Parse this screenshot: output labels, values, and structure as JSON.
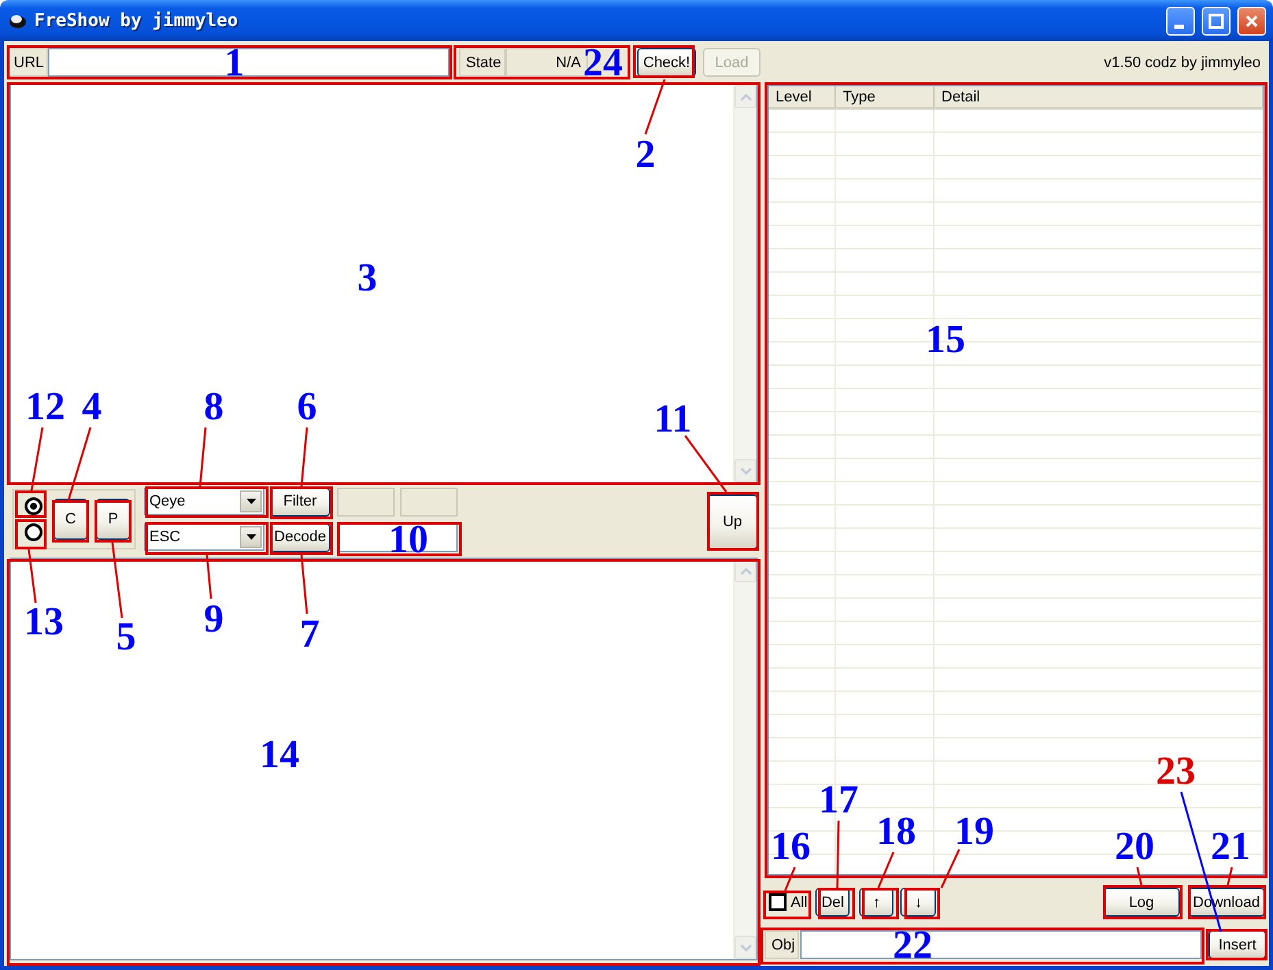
{
  "window": {
    "title": "FreShow by jimmyleo"
  },
  "top_bar": {
    "url_label": "URL",
    "state_label": "State",
    "state_value": "N/A",
    "check_button": "Check!",
    "load_button": {
      "label": "Load",
      "disabled": true
    },
    "version": "v1.50 codz by jimmyleo"
  },
  "mode_radios": [
    {
      "selected": true
    },
    {
      "selected": false
    }
  ],
  "c_button": "C",
  "p_button": "P",
  "dropdowns": [
    {
      "value": "Qeye"
    },
    {
      "value": "ESC"
    }
  ],
  "filter_button": "Filter",
  "decode_button": "Decode",
  "up_button": "Up",
  "table": {
    "columns": [
      "Level",
      "Type",
      "Detail"
    ]
  },
  "all_checkbox": {
    "label": "All",
    "checked": false
  },
  "list_buttons": [
    "Del",
    "↑",
    "↓"
  ],
  "log_button": "Log",
  "download_button": "Download",
  "obj": {
    "label": "Obj"
  },
  "insert_button": "Insert",
  "annotations": [
    {
      "number": "1",
      "color": "#0000ff"
    },
    {
      "number": "24",
      "color": "#0000ff"
    },
    {
      "number": "2",
      "color": "#0000ff"
    },
    {
      "number": "3",
      "color": "#0000ff"
    },
    {
      "number": "15",
      "color": "#0000ff"
    },
    {
      "number": "12",
      "color": "#0000ff"
    },
    {
      "number": "4",
      "color": "#0000ff"
    },
    {
      "number": "8",
      "color": "#0000ff"
    },
    {
      "number": "6",
      "color": "#0000ff"
    },
    {
      "number": "11",
      "color": "#0000ff"
    },
    {
      "number": "10",
      "color": "#0000ff"
    },
    {
      "number": "13",
      "color": "#0000ff"
    },
    {
      "number": "5",
      "color": "#0000ff"
    },
    {
      "number": "9",
      "color": "#0000ff"
    },
    {
      "number": "7",
      "color": "#0000ff"
    },
    {
      "number": "14",
      "color": "#0000ff"
    },
    {
      "number": "23",
      "color": "#dd0000"
    },
    {
      "number": "17",
      "color": "#0000ff"
    },
    {
      "number": "18",
      "color": "#0000ff"
    },
    {
      "number": "19",
      "color": "#0000ff"
    },
    {
      "number": "16",
      "color": "#0000ff"
    },
    {
      "number": "20",
      "color": "#0000ff"
    },
    {
      "number": "21",
      "color": "#0000ff"
    },
    {
      "number": "22",
      "color": "#0000ff"
    }
  ]
}
